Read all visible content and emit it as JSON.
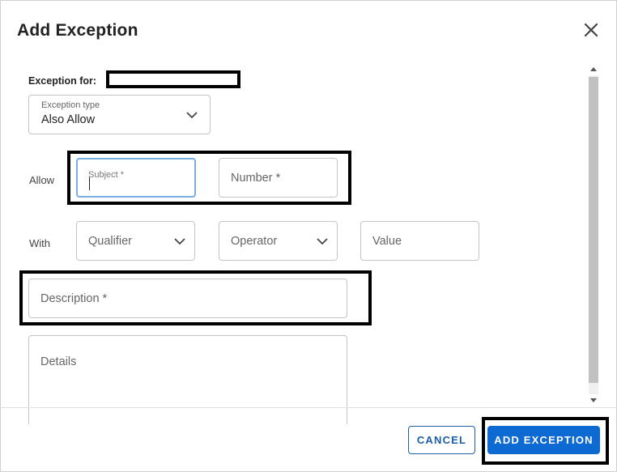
{
  "dialog": {
    "title": "Add Exception",
    "close_icon": "close-icon"
  },
  "exception_for": {
    "label": "Exception for:",
    "value": ""
  },
  "exception_type": {
    "label": "Exception type",
    "value": "Also Allow"
  },
  "allow_row": {
    "label": "Allow",
    "subject_label": "Subject *",
    "number_placeholder": "Number *"
  },
  "with_row": {
    "label": "With",
    "qualifier_placeholder": "Qualifier",
    "operator_placeholder": "Operator",
    "value_placeholder": "Value"
  },
  "description": {
    "placeholder": "Description *"
  },
  "details": {
    "placeholder": "Details"
  },
  "footer": {
    "cancel_label": "CANCEL",
    "add_label": "ADD EXCEPTION"
  },
  "colors": {
    "primary": "#0d6ad3",
    "focus": "#7aaee0",
    "border": "#c4c4c4"
  }
}
